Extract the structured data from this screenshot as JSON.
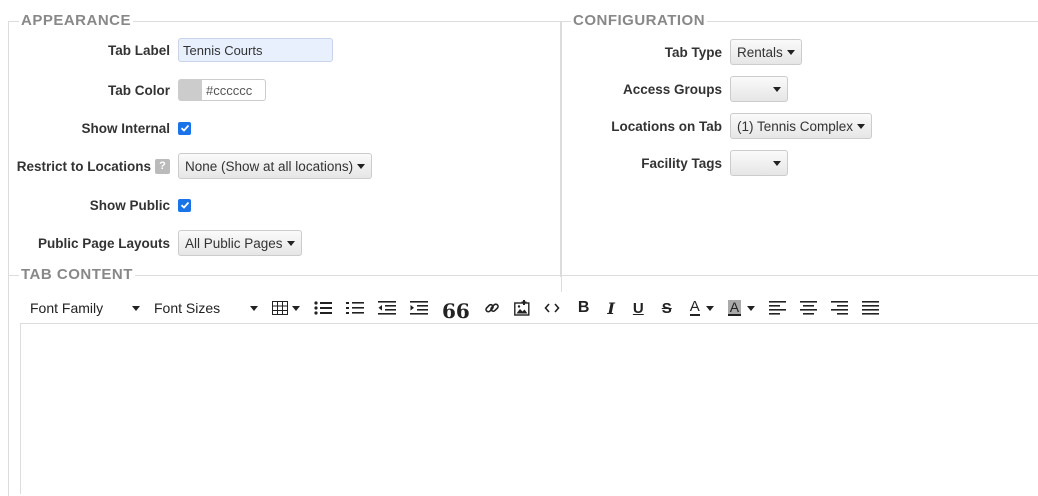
{
  "appearance": {
    "legend": "APPEARANCE",
    "tab_label": {
      "label": "Tab Label",
      "value": "Tennis Courts"
    },
    "tab_color": {
      "label": "Tab Color",
      "value": "#cccccc",
      "swatch": "#cccccc"
    },
    "show_internal": {
      "label": "Show Internal",
      "checked": true
    },
    "restrict": {
      "label": "Restrict to Locations",
      "help": "?",
      "value": "None (Show at all locations)"
    },
    "show_public": {
      "label": "Show Public",
      "checked": true
    },
    "public_layouts": {
      "label": "Public Page Layouts",
      "value": "All Public Pages"
    }
  },
  "configuration": {
    "legend": "CONFIGURATION",
    "tab_type": {
      "label": "Tab Type",
      "value": "Rentals"
    },
    "access_groups": {
      "label": "Access Groups",
      "value": ""
    },
    "locations": {
      "label": "Locations on Tab",
      "value": "(1) Tennis Complex"
    },
    "facility_tags": {
      "label": "Facility Tags",
      "value": ""
    }
  },
  "content": {
    "legend": "TAB CONTENT",
    "toolbar": {
      "font_family": "Font Family",
      "font_sizes": "Font Sizes",
      "quote": "66",
      "bold": "B",
      "italic": "I",
      "underline": "U",
      "strike": "S",
      "font_color": "A",
      "bg_color": "A"
    },
    "icons": [
      "table-icon",
      "bullet-list-icon",
      "numbered-list-icon",
      "outdent-icon",
      "indent-icon",
      "quote-icon",
      "link-icon",
      "image-icon",
      "code-icon",
      "bold-icon",
      "italic-icon",
      "underline-icon",
      "strikethrough-icon",
      "font-color-icon",
      "background-color-icon",
      "align-left-icon",
      "align-center-icon",
      "align-right-icon",
      "align-justify-icon"
    ]
  },
  "colors": {
    "accent": "#1a73e8",
    "legend": "#888888",
    "border": "#dcdcdc",
    "input_highlight": "#e8f0fe"
  }
}
